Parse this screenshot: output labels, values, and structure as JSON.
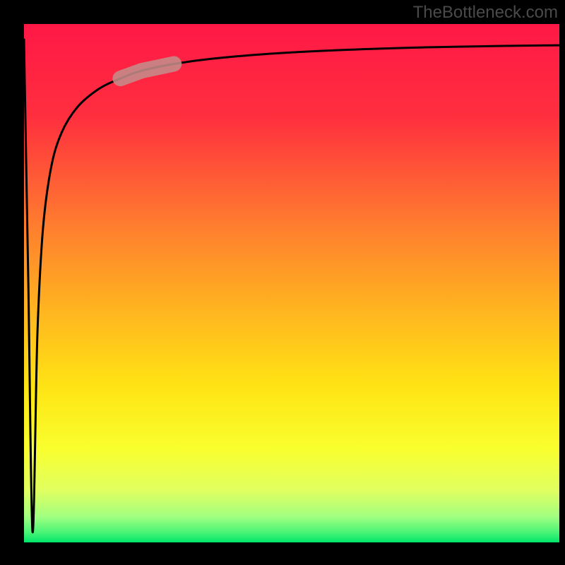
{
  "watermark": "TheBottleneck.com",
  "chart_data": {
    "type": "line",
    "title": "",
    "xlabel": "",
    "ylabel": "",
    "xlim": [
      0,
      100
    ],
    "ylim": [
      0,
      100
    ],
    "grid": false,
    "x": [
      0,
      0.8,
      1.6,
      2.5,
      3.5,
      5,
      7,
      10,
      14,
      18,
      22,
      28,
      35,
      45,
      55,
      65,
      75,
      85,
      95,
      100
    ],
    "y": [
      97,
      50,
      2,
      40,
      60,
      72,
      79,
      84,
      87.5,
      89.5,
      91,
      92.3,
      93.3,
      94.2,
      94.8,
      95.2,
      95.5,
      95.7,
      95.85,
      95.9
    ],
    "colors": {
      "curve": "#000000",
      "highlight": "#c48c89",
      "gradient_stops": [
        "#ff1846",
        "#ff2f3e",
        "#ff7a2f",
        "#ffb420",
        "#ffe414",
        "#f9ff2e",
        "#e0ff60",
        "#a2ff80",
        "#4cf577",
        "#00e56a"
      ]
    },
    "highlight_segment": {
      "x_start": 18,
      "x_end": 28
    }
  }
}
